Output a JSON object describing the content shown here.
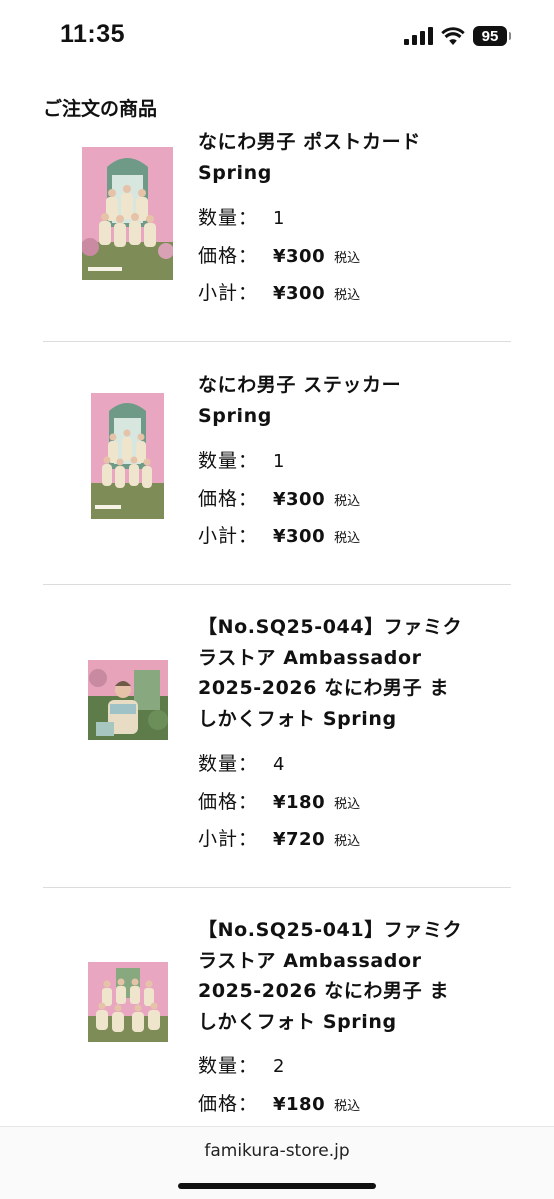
{
  "status_bar": {
    "time": "11:35",
    "battery": "95"
  },
  "section_title": "ご注文の商品",
  "labels": {
    "quantity": "数量：",
    "price": "価格：",
    "subtotal": "小計：",
    "tax": "税込"
  },
  "items": [
    {
      "name": "なにわ男子 ポストカード Spring",
      "quantity": "1",
      "price": "¥300",
      "subtotal": "¥300",
      "image": "group-photo-postcard"
    },
    {
      "name": "なにわ男子 ステッカー Spring",
      "quantity": "1",
      "price": "¥300",
      "subtotal": "¥300",
      "image": "group-photo-sticker"
    },
    {
      "name": "【No.SQ25-044】ファミクラストア Ambassador 2025-2026 なにわ男子 ましかくフォト Spring",
      "quantity": "4",
      "price": "¥180",
      "subtotal": "¥720",
      "image": "single-member-square-photo"
    },
    {
      "name": "【No.SQ25-041】ファミクラストア Ambassador 2025-2026 なにわ男子 ましかくフォト Spring",
      "quantity": "2",
      "price": "¥180",
      "subtotal": "",
      "image": "group-square-photo"
    }
  ],
  "footer": {
    "url": "famikura-store.jp"
  }
}
